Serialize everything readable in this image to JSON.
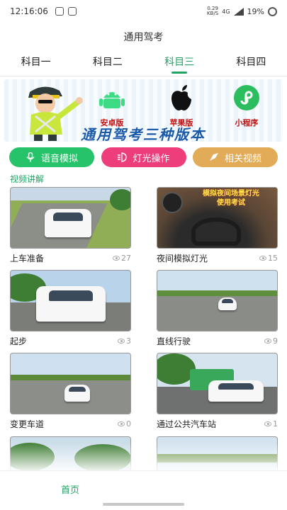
{
  "status": {
    "time": "12:16:06",
    "net_speed": "0.29",
    "net_unit": "KB/S",
    "network": "4G",
    "battery": "19%"
  },
  "app": {
    "title": "通用驾考"
  },
  "tabs": [
    {
      "label": "科目一",
      "active": false
    },
    {
      "label": "科目二",
      "active": false
    },
    {
      "label": "科目三",
      "active": true
    },
    {
      "label": "科目四",
      "active": false
    }
  ],
  "banner": {
    "platforms": [
      {
        "label": "安卓版",
        "icon": "android-icon",
        "color": "#3ddc84"
      },
      {
        "label": "苹果版",
        "icon": "apple-icon",
        "color": "#111111"
      },
      {
        "label": "小程序",
        "icon": "mini-program-icon",
        "color": "#2bbd5e"
      }
    ],
    "title": "通用驾考三种版本"
  },
  "actions": [
    {
      "label": "语音模拟",
      "icon": "microphone-icon",
      "color": "#27c36a"
    },
    {
      "label": "灯光操作",
      "icon": "light-icon",
      "color": "#ee3d7b"
    },
    {
      "label": "相关视频",
      "icon": "video-icon",
      "color": "#e2ab58"
    }
  ],
  "section": {
    "title": "视频讲解"
  },
  "videos": [
    {
      "title": "上车准备",
      "views": "27"
    },
    {
      "title": "夜间模拟灯光",
      "views": "15",
      "overlay_line1": "模拟夜间场景灯光",
      "overlay_line2": "使用考试"
    },
    {
      "title": "起步",
      "views": "3"
    },
    {
      "title": "直线行驶",
      "views": "9"
    },
    {
      "title": "变更车道",
      "views": "0"
    },
    {
      "title": "通过公共汽车站",
      "views": "1"
    }
  ],
  "nav": {
    "home": "首页"
  },
  "colors": {
    "accent": "#1fa463"
  }
}
